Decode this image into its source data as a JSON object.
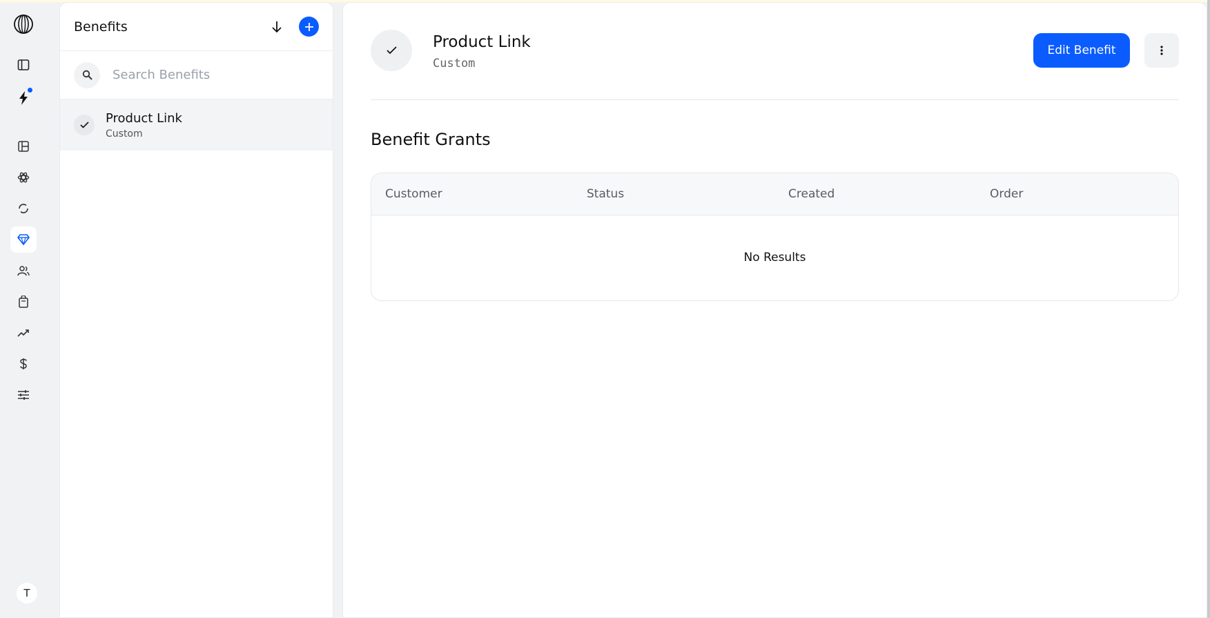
{
  "rail": {
    "items": [
      {
        "name": "toggle-sidebar-icon"
      },
      {
        "name": "bolt-icon",
        "badge": true
      },
      {
        "name": "dashboard-icon"
      },
      {
        "name": "products-icon"
      },
      {
        "name": "subscriptions-icon"
      },
      {
        "name": "benefits-icon",
        "active": true
      },
      {
        "name": "customers-icon"
      },
      {
        "name": "orders-icon"
      },
      {
        "name": "analytics-icon"
      },
      {
        "name": "finance-icon"
      },
      {
        "name": "settings-icon"
      }
    ],
    "avatar_initial": "T",
    "accent_color": "#0a5cff"
  },
  "list_panel": {
    "title": "Benefits",
    "search": {
      "placeholder": "Search Benefits",
      "value": ""
    },
    "items": [
      {
        "name": "Product Link",
        "type": "Custom",
        "selected": true
      }
    ]
  },
  "detail": {
    "title": "Product Link",
    "subtitle": "Custom",
    "edit_label": "Edit Benefit",
    "section_title": "Benefit Grants",
    "table": {
      "columns": [
        "Customer",
        "Status",
        "Created",
        "Order"
      ],
      "empty_text": "No Results"
    }
  }
}
